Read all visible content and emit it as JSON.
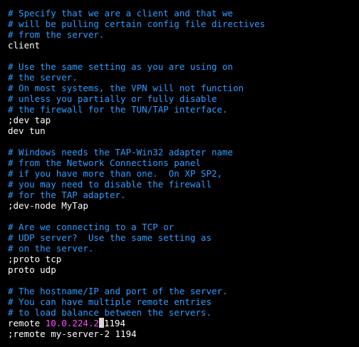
{
  "editor": {
    "colors": {
      "background": "#000000",
      "comment": "#2f9bff",
      "text": "#ffffff",
      "ip_highlight": "#ff4dff",
      "cursor": "#d8d8d8"
    },
    "lines": [
      "# Specify that we are a client and that we",
      "# will be pulling certain config file directives",
      "# from the server.",
      "client",
      "",
      "# Use the same setting as you are using on",
      "# the server.",
      "# On most systems, the VPN will not function",
      "# unless you partially or fully disable",
      "# the firewall for the TUN/TAP interface.",
      ";dev tap",
      "dev tun",
      "",
      "# Windows needs the TAP-Win32 adapter name",
      "# from the Network Connections panel",
      "# if you have more than one.  On XP SP2,",
      "# you may need to disable the firewall",
      "# for the TAP adapter.",
      ";dev-node MyTap",
      "",
      "# Are we connecting to a TCP or",
      "# UDP server?  Use the same setting as",
      "# on the server.",
      ";proto tcp",
      "proto udp",
      "",
      "# The hostname/IP and port of the server.",
      "# You can have multiple remote entries",
      "# to load balance between the servers."
    ],
    "remote_line": {
      "keyword": "remote ",
      "ip": "10.0.224.2",
      "port": "1194"
    },
    "last_line": ";remote my-server-2 1194"
  }
}
